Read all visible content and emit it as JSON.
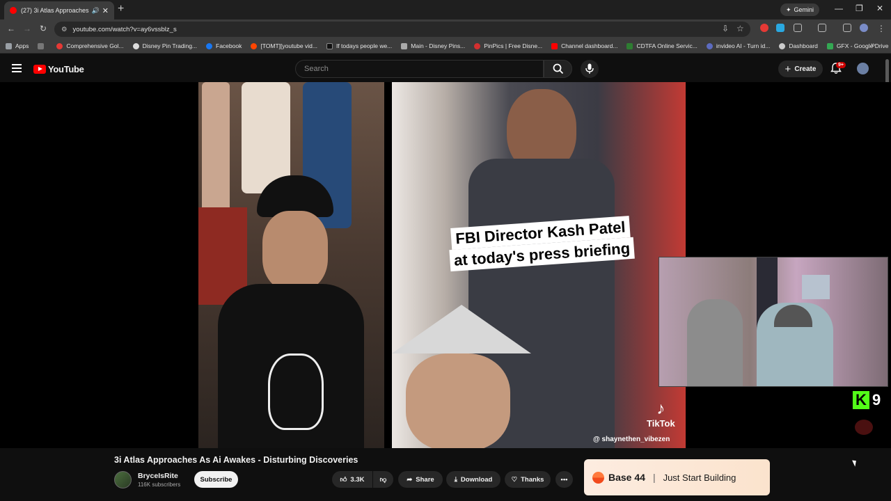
{
  "browser": {
    "tab_title": "(27) 3i Atlas Approaches As Ai Awakes - Disturbing Discoveries - YouTube",
    "new_tab_glyph": "+",
    "gemini_label": "Gemini",
    "url": "youtube.com/watch?v=ay6vssblz_s",
    "bookmarks": [
      {
        "label": "Apps",
        "color": "#e0e0e0"
      },
      {
        "label": "Comprehensive Gol...",
        "color": "#e53935"
      },
      {
        "label": "Disney Pin Trading...",
        "color": "#dddddd"
      },
      {
        "label": "Facebook",
        "color": "#1877f2"
      },
      {
        "label": "[TOMT][youtube vid...",
        "color": "#ff4500"
      },
      {
        "label": "If todays people we...",
        "color": "#111111"
      },
      {
        "label": "Main - Disney Pins...",
        "color": "#aaaaaa"
      },
      {
        "label": "PinPics | Free Disne...",
        "color": "#d32f2f"
      },
      {
        "label": "Channel dashboard...",
        "color": "#ff0000"
      },
      {
        "label": "CDTFA Online Servic...",
        "color": "#2e7d32"
      },
      {
        "label": "invideo AI - Turn id...",
        "color": "#5c6bc0"
      },
      {
        "label": "Dashboard",
        "color": "#cccccc"
      },
      {
        "label": "GFX - Google Drive",
        "color": "#34a853"
      }
    ]
  },
  "youtube": {
    "logo_text": "YouTube",
    "search_placeholder": "Search",
    "create_label": "Create",
    "notifications_badge": "9+"
  },
  "video": {
    "caption_line1": "FBI Director Kash Patel",
    "caption_line2": "at today's press briefing",
    "tiktok_label": "TikTok",
    "tiktok_handle": "@ shaynethen_vibezen",
    "kick_letter": "K",
    "kick_count": "9"
  },
  "meta": {
    "title": "3i Atlas Approaches As Ai Awakes - Disturbing Discoveries",
    "channel_name": "BryceIsRite",
    "subscribers": "116K subscribers",
    "subscribe_label": "Subscribe",
    "likes": "3.3K",
    "share_label": "Share",
    "download_label": "Download",
    "thanks_label": "Thanks"
  },
  "ad": {
    "brand": "Base 44",
    "separator": "|",
    "tagline": "Just Start Building"
  },
  "colors": {
    "youtube_red": "#ff0000",
    "kick_green": "#53fc18",
    "background": "#0f0f0f"
  }
}
